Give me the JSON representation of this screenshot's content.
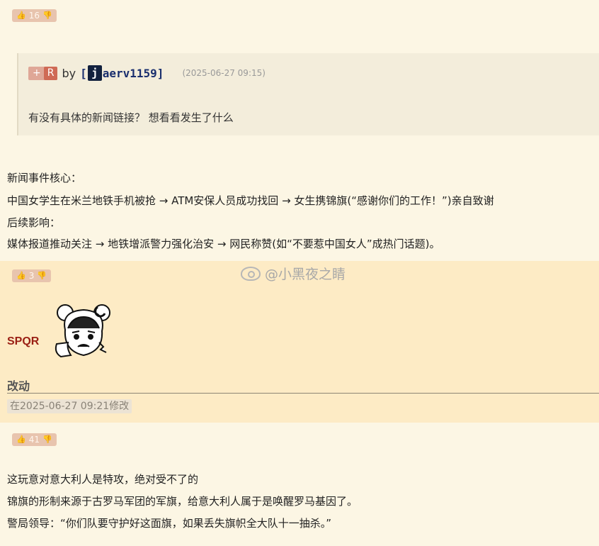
{
  "top_vote": {
    "count": "16"
  },
  "quote": {
    "plus_label": "+",
    "r_label": "R",
    "by_label": "by",
    "user_open": "[",
    "user_avatar_letter": "j",
    "user_name": "aerv1159",
    "user_close": "]",
    "timestamp": "(2025-06-27 09:15)",
    "text": "有没有具体的新闻链接？ 想看看发生了什么"
  },
  "reply": {
    "lines": [
      "新闻事件核心：",
      "中国女学生在米兰地铁手机被抢 → ATM安保人员成功找回 → 女生携锦旗(“感谢你们的工作！”)亲自致谢",
      "后续影响：",
      "媒体报道推动关注 → 地铁增派警力强化治安 → 网民称赞(如“不要惹中国女人”成热门话题)。"
    ]
  },
  "spqr_post": {
    "vote_count": "3",
    "username": "SPQR",
    "title": "改动",
    "edit_note": "在2025-06-27 09:21修改"
  },
  "watermark": {
    "text": "@小黑夜之睛"
  },
  "bottom_post": {
    "vote_count": "41",
    "lines": [
      "这玩意对意大利人是特攻，绝对受不了的",
      "锦旗的形制来源于古罗马军团的军旗，给意大利人属于是唤醒罗马基因了。",
      "警局领导：“你们队要守护好这面旗，如果丢失旗帜全大队十一抽杀。”"
    ]
  },
  "icons": {
    "thumb": "thumbs-up-icon",
    "down": "thumbs-down-icon"
  },
  "colors": {
    "background": "#fcf6e4",
    "highlight": "#fdebc5",
    "vote_badge": "#e8c4ae",
    "username": "#9a1f14",
    "link_user": "#1a2f6e"
  }
}
